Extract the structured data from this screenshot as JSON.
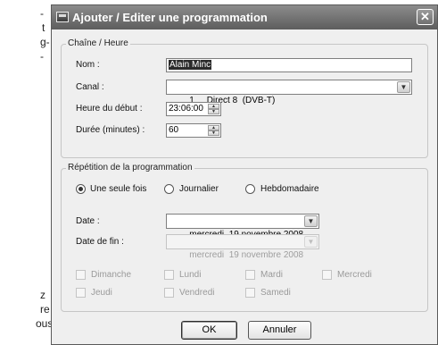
{
  "background_text": [
    "-",
    "t",
    "g-",
    "-",
    "z",
    "re",
    "ous"
  ],
  "dialog": {
    "title": "Ajouter / Editer une programmation",
    "close_glyph": "✕",
    "channel_group": {
      "legend": "Chaîne / Heure",
      "name_label": "Nom :",
      "name_value": "Alain Minc",
      "channel_label": "Canal :",
      "channel_value": "1     Direct 8  (DVB-T)",
      "start_label": "Heure du début :",
      "start_value": "23:06:00",
      "duration_label": "Durée (minutes) :",
      "duration_value": "60"
    },
    "repeat_group": {
      "legend": "Répétition de la programmation",
      "options": [
        {
          "label": "Une seule fois",
          "checked": true
        },
        {
          "label": "Journalier",
          "checked": false
        },
        {
          "label": "Hebdomadaire",
          "checked": false
        }
      ],
      "date_label": "Date :",
      "date_value": "mercredi  19 novembre 2008",
      "end_date_label": "Date de fin :",
      "end_date_value": "mercredi  19 novembre 2008",
      "days": [
        "Dimanche",
        "Lundi",
        "Mardi",
        "Mercredi",
        "Jeudi",
        "Vendredi",
        "Samedi"
      ]
    },
    "ok_label": "OK",
    "cancel_label": "Annuler"
  },
  "icons": {
    "dropdown": "chevron-down-icon",
    "spin_up": "arrow-up-icon",
    "spin_down": "arrow-down-icon"
  }
}
